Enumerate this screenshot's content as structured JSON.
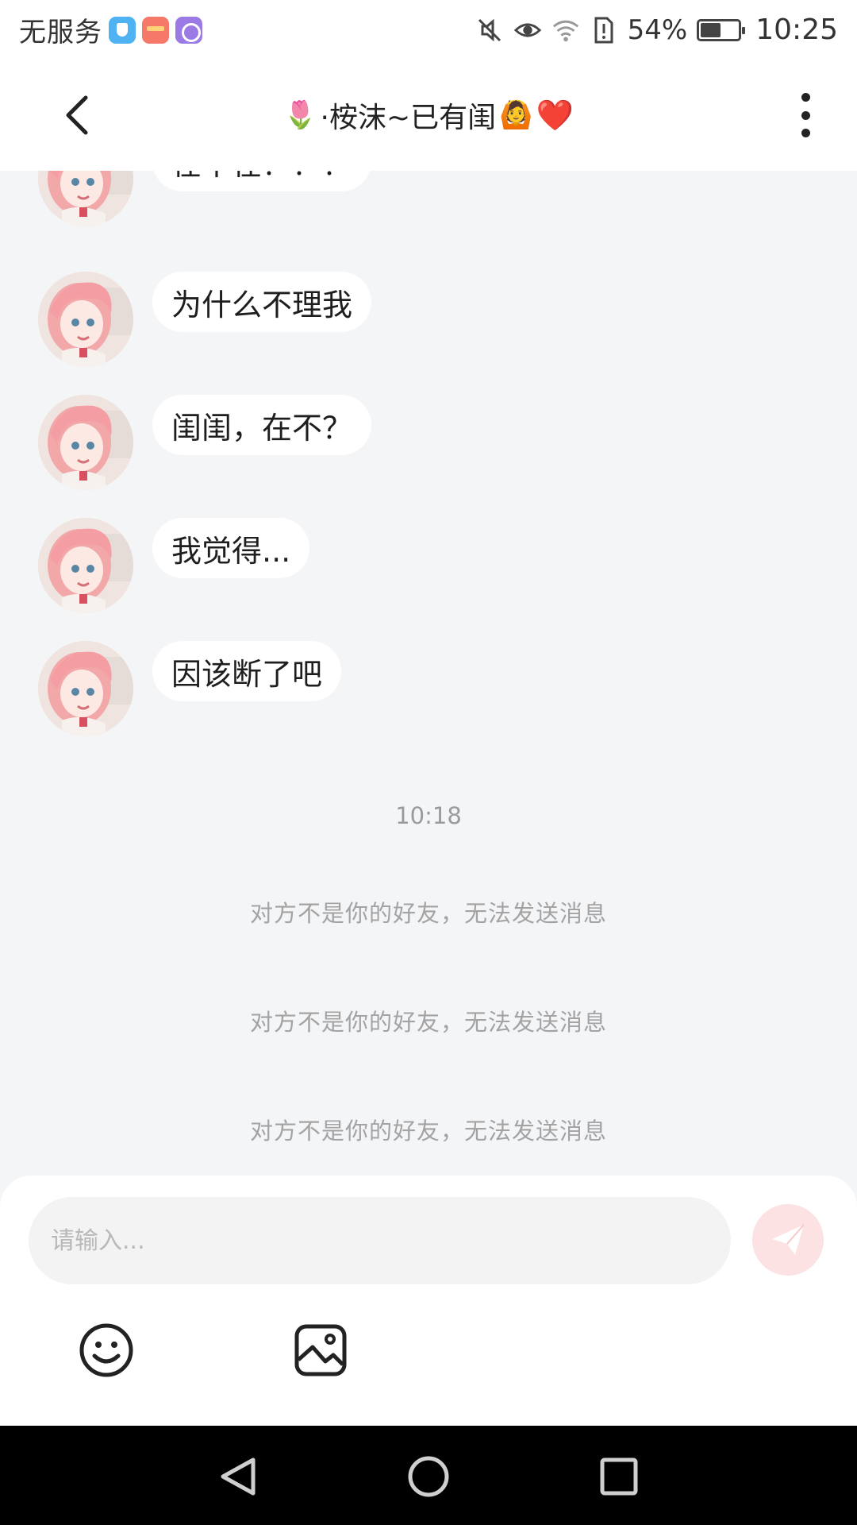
{
  "status_bar": {
    "carrier": "无服务",
    "battery_percent": "54%",
    "battery_level": 0.54,
    "time": "10:25",
    "icons": [
      "shield-app-icon",
      "wallet-app-icon",
      "pie-app-icon",
      "mute-icon",
      "eye-comfort-icon",
      "wifi-icon",
      "alert-sim-icon",
      "battery-icon"
    ]
  },
  "header": {
    "title_prefix_emoji": "🌷",
    "title_text": "·桉沫~已有闺",
    "title_suffix_emoji": "🙆",
    "title_heart": "❤️",
    "back_icon": "chevron-left-icon",
    "more_icon": "more-vertical-icon"
  },
  "messages": [
    {
      "text": "在不在？？？"
    },
    {
      "text": "为什么不理我"
    },
    {
      "text": "闺闺，在不？"
    },
    {
      "text": "我觉得..."
    },
    {
      "text": "因该断了吧"
    }
  ],
  "timestamp": "10:18",
  "system_notes": [
    "对方不是你的好友，无法发送消息",
    "对方不是你的好友，无法发送消息",
    "对方不是你的好友，无法发送消息"
  ],
  "composer": {
    "placeholder": "请输入...",
    "value": "",
    "send_icon": "paper-plane-icon",
    "emoji_icon": "smiley-icon",
    "image_icon": "image-icon"
  },
  "colors": {
    "accent_send": "#f26d6d",
    "chat_background": "#f4f5f7",
    "bubble": "#ffffff"
  }
}
